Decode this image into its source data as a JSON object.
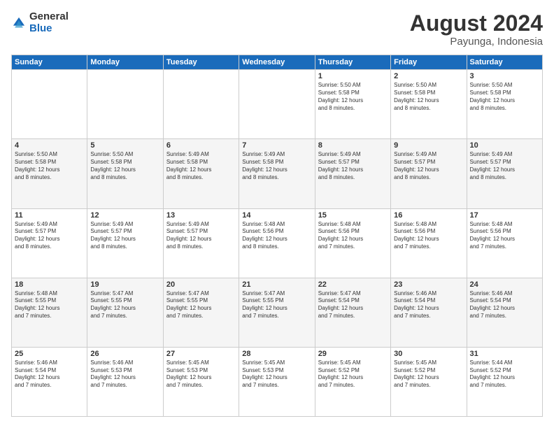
{
  "logo": {
    "general": "General",
    "blue": "Blue"
  },
  "title": "August 2024",
  "subtitle": "Payunga, Indonesia",
  "headers": [
    "Sunday",
    "Monday",
    "Tuesday",
    "Wednesday",
    "Thursday",
    "Friday",
    "Saturday"
  ],
  "weeks": [
    [
      {
        "num": "",
        "info": ""
      },
      {
        "num": "",
        "info": ""
      },
      {
        "num": "",
        "info": ""
      },
      {
        "num": "",
        "info": ""
      },
      {
        "num": "1",
        "info": "Sunrise: 5:50 AM\nSunset: 5:58 PM\nDaylight: 12 hours\nand 8 minutes."
      },
      {
        "num": "2",
        "info": "Sunrise: 5:50 AM\nSunset: 5:58 PM\nDaylight: 12 hours\nand 8 minutes."
      },
      {
        "num": "3",
        "info": "Sunrise: 5:50 AM\nSunset: 5:58 PM\nDaylight: 12 hours\nand 8 minutes."
      }
    ],
    [
      {
        "num": "4",
        "info": "Sunrise: 5:50 AM\nSunset: 5:58 PM\nDaylight: 12 hours\nand 8 minutes."
      },
      {
        "num": "5",
        "info": "Sunrise: 5:50 AM\nSunset: 5:58 PM\nDaylight: 12 hours\nand 8 minutes."
      },
      {
        "num": "6",
        "info": "Sunrise: 5:49 AM\nSunset: 5:58 PM\nDaylight: 12 hours\nand 8 minutes."
      },
      {
        "num": "7",
        "info": "Sunrise: 5:49 AM\nSunset: 5:58 PM\nDaylight: 12 hours\nand 8 minutes."
      },
      {
        "num": "8",
        "info": "Sunrise: 5:49 AM\nSunset: 5:57 PM\nDaylight: 12 hours\nand 8 minutes."
      },
      {
        "num": "9",
        "info": "Sunrise: 5:49 AM\nSunset: 5:57 PM\nDaylight: 12 hours\nand 8 minutes."
      },
      {
        "num": "10",
        "info": "Sunrise: 5:49 AM\nSunset: 5:57 PM\nDaylight: 12 hours\nand 8 minutes."
      }
    ],
    [
      {
        "num": "11",
        "info": "Sunrise: 5:49 AM\nSunset: 5:57 PM\nDaylight: 12 hours\nand 8 minutes."
      },
      {
        "num": "12",
        "info": "Sunrise: 5:49 AM\nSunset: 5:57 PM\nDaylight: 12 hours\nand 8 minutes."
      },
      {
        "num": "13",
        "info": "Sunrise: 5:49 AM\nSunset: 5:57 PM\nDaylight: 12 hours\nand 8 minutes."
      },
      {
        "num": "14",
        "info": "Sunrise: 5:48 AM\nSunset: 5:56 PM\nDaylight: 12 hours\nand 8 minutes."
      },
      {
        "num": "15",
        "info": "Sunrise: 5:48 AM\nSunset: 5:56 PM\nDaylight: 12 hours\nand 7 minutes."
      },
      {
        "num": "16",
        "info": "Sunrise: 5:48 AM\nSunset: 5:56 PM\nDaylight: 12 hours\nand 7 minutes."
      },
      {
        "num": "17",
        "info": "Sunrise: 5:48 AM\nSunset: 5:56 PM\nDaylight: 12 hours\nand 7 minutes."
      }
    ],
    [
      {
        "num": "18",
        "info": "Sunrise: 5:48 AM\nSunset: 5:55 PM\nDaylight: 12 hours\nand 7 minutes."
      },
      {
        "num": "19",
        "info": "Sunrise: 5:47 AM\nSunset: 5:55 PM\nDaylight: 12 hours\nand 7 minutes."
      },
      {
        "num": "20",
        "info": "Sunrise: 5:47 AM\nSunset: 5:55 PM\nDaylight: 12 hours\nand 7 minutes."
      },
      {
        "num": "21",
        "info": "Sunrise: 5:47 AM\nSunset: 5:55 PM\nDaylight: 12 hours\nand 7 minutes."
      },
      {
        "num": "22",
        "info": "Sunrise: 5:47 AM\nSunset: 5:54 PM\nDaylight: 12 hours\nand 7 minutes."
      },
      {
        "num": "23",
        "info": "Sunrise: 5:46 AM\nSunset: 5:54 PM\nDaylight: 12 hours\nand 7 minutes."
      },
      {
        "num": "24",
        "info": "Sunrise: 5:46 AM\nSunset: 5:54 PM\nDaylight: 12 hours\nand 7 minutes."
      }
    ],
    [
      {
        "num": "25",
        "info": "Sunrise: 5:46 AM\nSunset: 5:54 PM\nDaylight: 12 hours\nand 7 minutes."
      },
      {
        "num": "26",
        "info": "Sunrise: 5:46 AM\nSunset: 5:53 PM\nDaylight: 12 hours\nand 7 minutes."
      },
      {
        "num": "27",
        "info": "Sunrise: 5:45 AM\nSunset: 5:53 PM\nDaylight: 12 hours\nand 7 minutes."
      },
      {
        "num": "28",
        "info": "Sunrise: 5:45 AM\nSunset: 5:53 PM\nDaylight: 12 hours\nand 7 minutes."
      },
      {
        "num": "29",
        "info": "Sunrise: 5:45 AM\nSunset: 5:52 PM\nDaylight: 12 hours\nand 7 minutes."
      },
      {
        "num": "30",
        "info": "Sunrise: 5:45 AM\nSunset: 5:52 PM\nDaylight: 12 hours\nand 7 minutes."
      },
      {
        "num": "31",
        "info": "Sunrise: 5:44 AM\nSunset: 5:52 PM\nDaylight: 12 hours\nand 7 minutes."
      }
    ]
  ]
}
